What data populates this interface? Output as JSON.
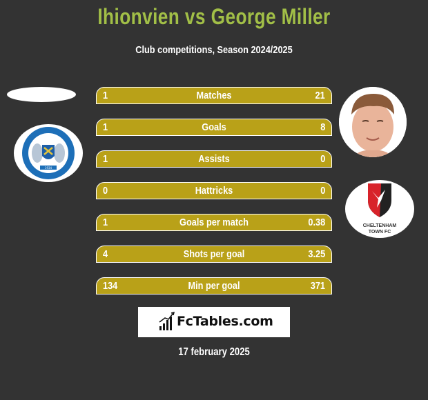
{
  "header": {
    "title": "Ihionvien vs George Miller",
    "subtitle": "Club competitions, Season 2024/2025"
  },
  "colors": {
    "title": "#a2bf47",
    "bar": "#b9a118",
    "background": "#333333"
  },
  "left_team": {
    "badge_icon": "peterborough-united-crest-icon",
    "badge_text": "PETERBOROUGH UNITED FOOTBALL CLUB",
    "badge_year": "1934"
  },
  "right_player": {
    "photo_icon": "player-photo-icon"
  },
  "right_team": {
    "badge_icon": "cheltenham-town-crest-icon",
    "badge_line1": "CHELTENHAM",
    "badge_line2": "TOWN FC"
  },
  "stats": [
    {
      "label": "Matches",
      "left": "1",
      "right": "21"
    },
    {
      "label": "Goals",
      "left": "1",
      "right": "8"
    },
    {
      "label": "Assists",
      "left": "1",
      "right": "0"
    },
    {
      "label": "Hattricks",
      "left": "0",
      "right": "0"
    },
    {
      "label": "Goals per match",
      "left": "1",
      "right": "0.38"
    },
    {
      "label": "Shots per goal",
      "left": "4",
      "right": "3.25"
    },
    {
      "label": "Min per goal",
      "left": "134",
      "right": "371"
    }
  ],
  "footer": {
    "brand": "FcTables.com",
    "brand_icon": "bar-chart-icon",
    "date": "17 february 2025"
  }
}
